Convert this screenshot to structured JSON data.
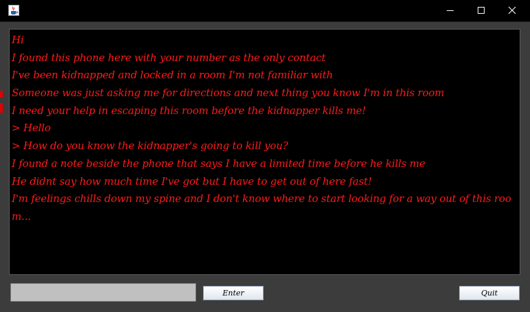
{
  "window": {
    "controls": {
      "minimize_icon": "minimize-icon",
      "maximize_icon": "maximize-icon",
      "close_icon": "close-icon"
    },
    "app_icon": "java-cup-icon"
  },
  "console": {
    "text_color": "#ff1a1a",
    "background": "#000000",
    "lines": [
      "Hi",
      "I found this phone here with your number as the only contact",
      "I've been kidnapped and locked in a room I'm not familiar with",
      "Someone was just asking me for directions and next thing you know I'm in this room",
      "I need your help in escaping this room before the kidnapper kills me!",
      "> Hello",
      "> How do you know the kidnapper's going to kill you?",
      "I found a note beside the phone that says I have a limited time before he kills me",
      "He didnt say how much time I've got but I have to get out of here fast!",
      "I'm feelings chills down my spine and I don't know where to start looking for a way out of this roo",
      "m..."
    ]
  },
  "input": {
    "value": ""
  },
  "buttons": {
    "enter_label": "Enter",
    "quit_label": "Quit"
  }
}
